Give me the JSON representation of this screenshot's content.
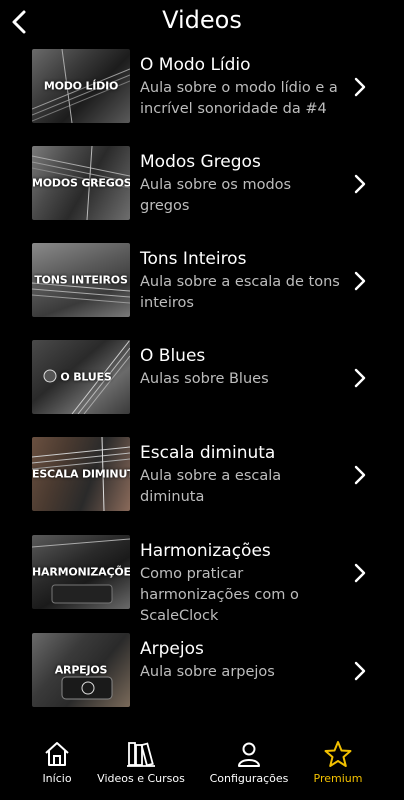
{
  "header": {
    "title": "Videos"
  },
  "videos": [
    {
      "thumb_label": "MODO LÍDIO",
      "title": "O Modo Lídio",
      "description": "Aula sobre o modo lídio e a incrível sonoridade da #4"
    },
    {
      "thumb_label": "MODOS GREGOS",
      "title": "Modos Gregos",
      "description": "Aula sobre os modos gregos"
    },
    {
      "thumb_label": "TONS INTEIROS",
      "title": "Tons Inteiros",
      "description": "Aula sobre a escala de tons inteiros"
    },
    {
      "thumb_label": "O BLUES",
      "title": "O Blues",
      "description": "Aulas sobre Blues"
    },
    {
      "thumb_label": "ESCALA DIMINUTA",
      "title": "Escala diminuta",
      "description": "Aula sobre a escala diminuta"
    },
    {
      "thumb_label": "HARMONIZAÇÕES",
      "title": "Harmonizações",
      "description": "Como praticar harmonizações com o ScaleClock"
    },
    {
      "thumb_label": "ARPEJOS",
      "title": "Arpejos",
      "description": "Aula sobre arpejos"
    }
  ],
  "tabs": [
    {
      "label": "Início",
      "icon": "home-icon"
    },
    {
      "label": "Videos e Cursos",
      "icon": "books-icon"
    },
    {
      "label": "Configurações",
      "icon": "user-icon"
    },
    {
      "label": "Premium",
      "icon": "star-icon"
    }
  ],
  "colors": {
    "background": "#000000",
    "accent": "#f2c000",
    "text": "#ffffff",
    "secondary_text": "#bdbdbd"
  }
}
